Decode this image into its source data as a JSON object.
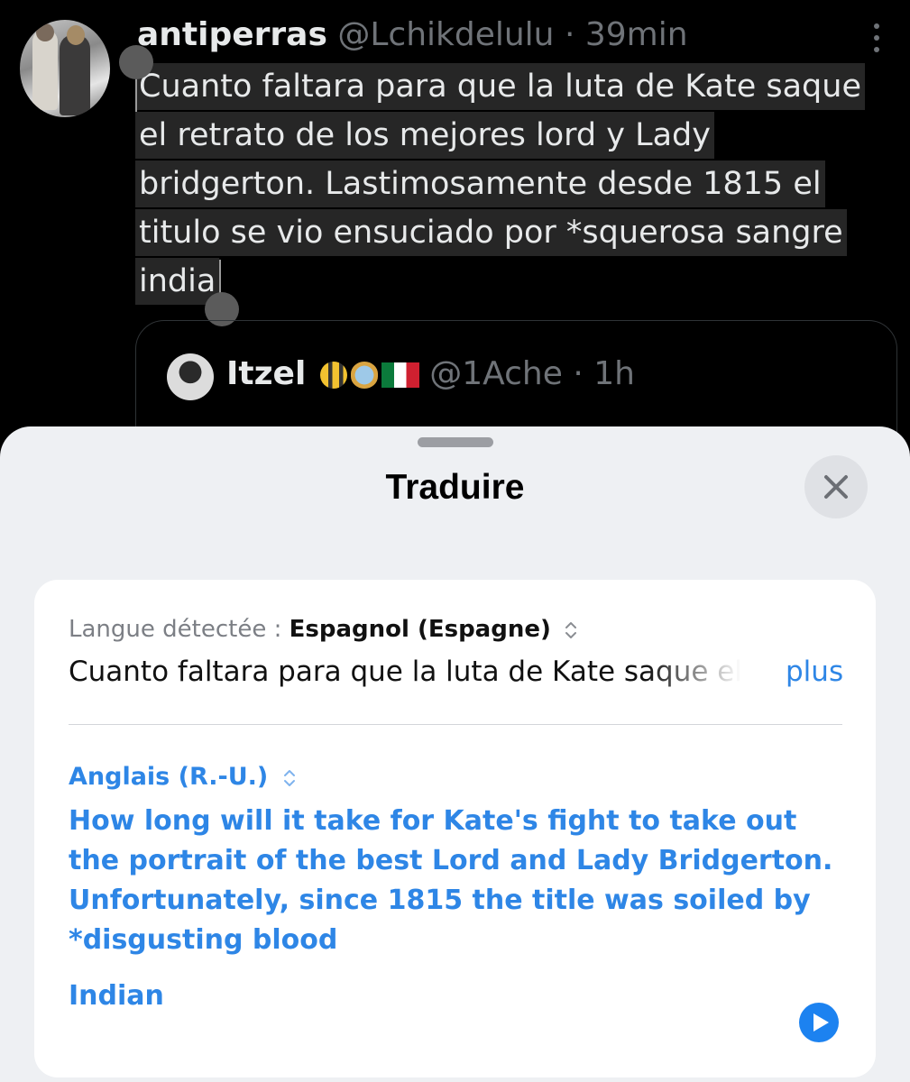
{
  "tweet": {
    "name": "antiperras",
    "handle": "@Lchikdelulu",
    "separator": " · ",
    "time": "39min",
    "lines": [
      "Cuanto faltara para que la luta de Kate saque",
      "el retrato de los mejores lord y Lady",
      "bridgerton. Lastimosamente desde 1815 el",
      "titulo se vio ensuciado por *squerosa sangre",
      "india"
    ]
  },
  "quoted_tweet": {
    "name": "Itzel",
    "handle": "@1Ache",
    "separator": " · ",
    "time": "1h"
  },
  "sheet": {
    "title": "Traduire",
    "detected_label": "Langue détectée : ",
    "source_language": "Espagnol (Espagne)",
    "source_text": "Cuanto faltara para que la luta de Kate saque el retrato de los mejores lord y Lady bridgerton. Lastimosamente desde 1815 el titulo se vio ensuciado por *squerosa sangre india",
    "more_label": "plus",
    "target_language": "Anglais (R.-U.)",
    "translation_lines": [
      "How long will it take for Kate's fight to take out",
      "the portrait of the best Lord and Lady Bridgerton.",
      "Unfortunately, since 1815 the title was soiled by",
      "*disgusting blood"
    ],
    "translation_last": "Indian"
  },
  "icons": {
    "close": "close-icon",
    "more": "more-vertical-icon",
    "play": "play-icon",
    "language_picker": "updown-chevron-icon"
  },
  "colors": {
    "accent": "#2e86e6",
    "sheet_bg": "#eef0f3",
    "card_bg": "#ffffff",
    "tweet_bg": "#000000"
  }
}
